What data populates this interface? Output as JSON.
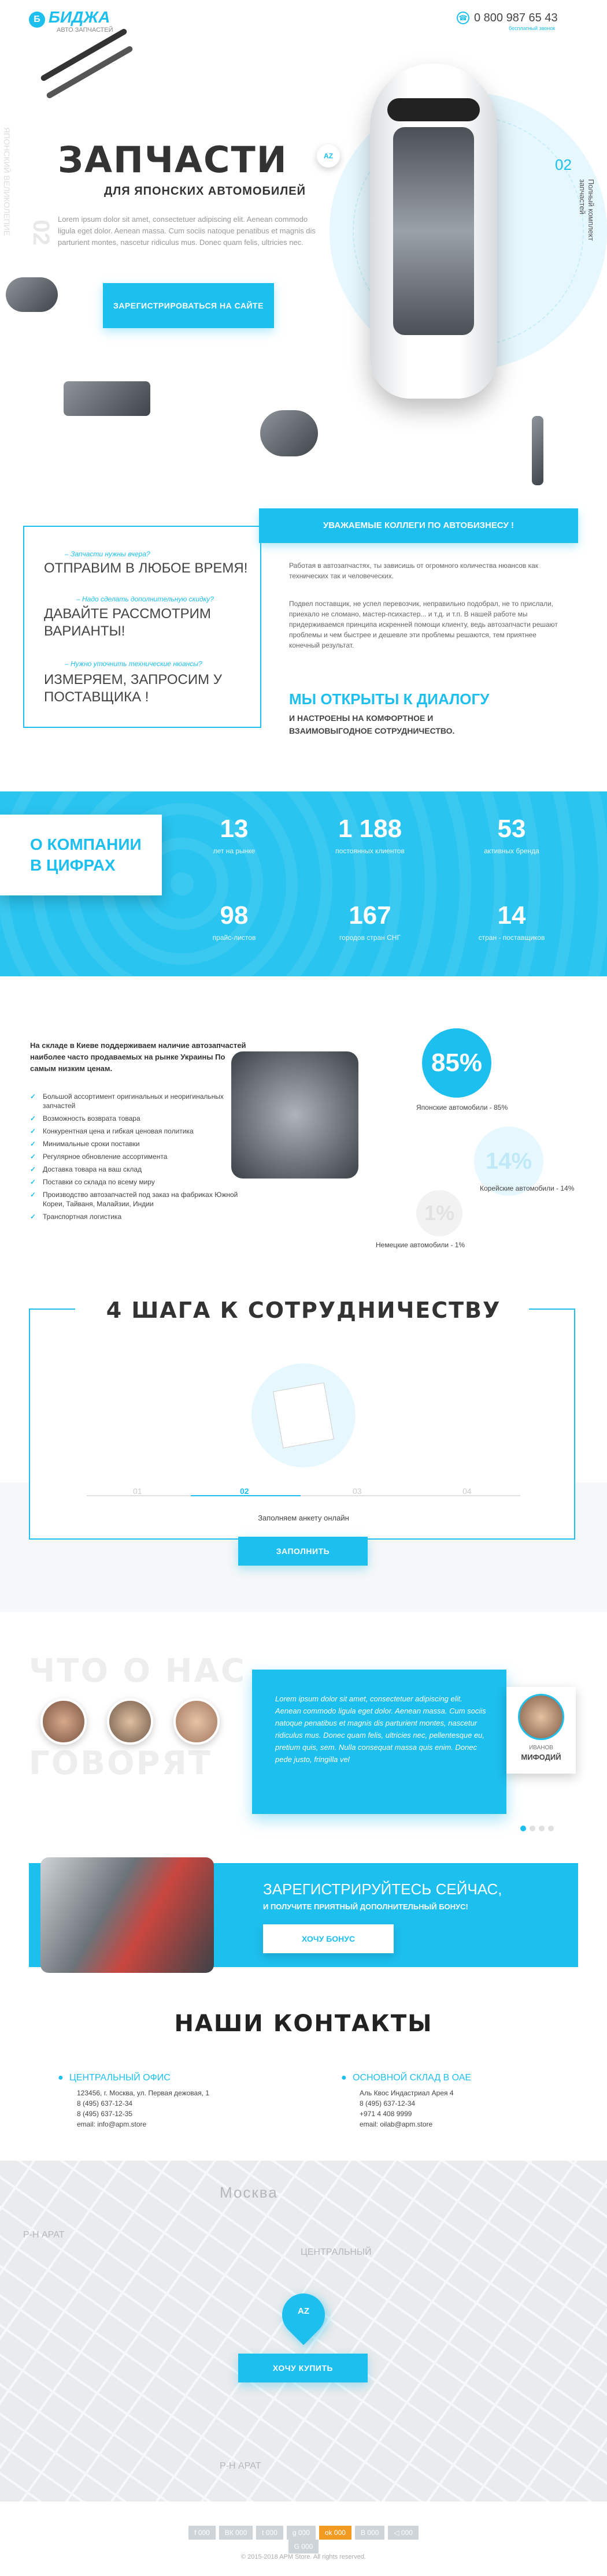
{
  "header": {
    "brand": "БИДЖА",
    "tagline": "АВТО ЗАПЧАСТЕЙ",
    "phone": "0 800 987 65 43",
    "phone_note": "бесплатный звонок"
  },
  "hero": {
    "title": "ЗАПЧАСТИ",
    "subtitle": "ДЛЯ ЯПОНСКИХ АВТОМОБИЛЕЙ",
    "text": "Lorem ipsum dolor sit amet, consectetuer adipiscing elit. Aenean commodo ligula eget dolor. Aenean massa. Cum sociis natoque penatibus et magnis dis parturient montes, nascetur ridiculus mus. Donec quam felis, ultricies nec.",
    "button": "ЗАРЕГИСТРИРОВАТЬСЯ НА САЙТЕ",
    "side_left": "ЯПОНСКИЙ ВЕЛИКОЛЕПИЕ",
    "side_num_left": "02",
    "side_num_right": "02",
    "side_right": "Полный комплект запчастей"
  },
  "collegues": {
    "q1": "– Запчасти нужны вчера?",
    "a1": "ОТПРАВИМ В ЛЮБОЕ ВРЕМЯ!",
    "q2": "– Надо сделать дополнительную скидку?",
    "a2": "ДАВАЙТЕ РАССМОТРИМ ВАРИАНТЫ!",
    "q3": "– Нужно уточнить технические нюансы?",
    "a3": "ИЗМЕРЯЕМ, ЗАПРОСИМ У ПОСТАВЩИКА !",
    "banner": "УВАЖАЕМЫЕ КОЛЛЕГИ ПО АВТОБИЗНЕСУ !",
    "p1": "Работая в автозапчастях, ты зависишь от огромного количества нюансов как технических так и человеческих.",
    "p2": "Подвел поставщик, не успел перевозчик, неправильно подобрал, не то прислали, приехало не сломано, мастер-психастер... и т.д. и т.п. В нашей работе мы придерживаемся принципа искренней помощи клиенту, ведь автозапчасти решают проблемы и чем быстрее и дешевле эти проблемы решаются, тем приятнее конечный результат.",
    "open": "МЫ ОТКРЫТЫ К ДИАЛОГУ",
    "open_sub": "И НАСТРОЕНЫ НА КОМФОРТНОЕ И ВЗАИМОВЫГОДНОЕ СОТРУДНИЧЕСТВО."
  },
  "about": {
    "title": "О КОМПАНИИ В ЦИФРАХ",
    "stats": [
      {
        "n": "13",
        "l": "лет на рынке"
      },
      {
        "n": "1 188",
        "l": "постоянных клиентов"
      },
      {
        "n": "53",
        "l": "активных бренда"
      },
      {
        "n": "98",
        "l": "прайс-листов"
      },
      {
        "n": "167",
        "l": "городов стран СНГ"
      },
      {
        "n": "14",
        "l": "стран - поставщиков"
      }
    ]
  },
  "stock": {
    "intro": "На складе в Киеве поддерживаем наличие автозапчастей наиболее часто продаваемых на рынке Украины По самым низким ценам.",
    "items": [
      "Большой ассортимент оригинальных и неоригинальных запчастей",
      "Возможность возврата товара",
      "Конкурентная цена и гибкая ценовая политика",
      "Минимальные сроки поставки",
      "Регулярное обновление ассортимента",
      "Доставка товара на ваш склад",
      "Поставки со склада по всему миру",
      "Производство автозапчастей под заказ на фабриках Южной Кореи, Тайваня, Малайзии, Индии",
      "Транспортная логистика"
    ],
    "p1": "85%",
    "l1": "Японские автомобили - 85%",
    "p2": "14%",
    "l2": "Корейские автомобили - 14%",
    "p3": "1%",
    "l3": "Немецкие автомобили - 1%"
  },
  "steps": {
    "title": "4 ШАГА К СОТРУДНИЧЕСТВУ",
    "s1": "01",
    "s2": "02",
    "s3": "03",
    "s4": "04",
    "caption": "Заполняем анкету онлайн",
    "button": "ЗАПОЛНИТЬ"
  },
  "reviews": {
    "t1": "ЧТО О НАС",
    "t2": "ГОВОРЯТ",
    "text": "Lorem ipsum dolor sit amet, consectetuer adipiscing elit. Aenean commodo ligula eget dolor. Aenean massa. Cum sociis natoque penatibus et magnis dis parturient montes, nascetur ridiculus mus. Donec quam felis, ultricies nec, pellentesque eu, pretium quis, sem. Nulla consequat massa quis enim. Donec pede justo, fringilla vel",
    "name1": "ИВАНОВ",
    "name2": "МИФОДИЙ"
  },
  "register": {
    "title": "ЗАРЕГИСТРИРУЙТЕСЬ СЕЙЧАС,",
    "sub": "И ПОЛУЧИТЕ ПРИЯТНЫЙ ДОПОЛНИТЕЛЬНЫЙ БОНУС!",
    "button": "ХОЧУ БОНУС"
  },
  "contacts": {
    "title": "НАШИ КОНТАКТЫ",
    "o1": "ЦЕНТРАЛЬНЫЙ ОФИС",
    "o1_addr": "123456, г. Москва, ул. Первая дежовая, 1",
    "o1_p1": "8 (495) 637-12-34",
    "o1_p2": "8 (495) 637-12-35",
    "o1_mail": "email: info@apm.store",
    "o2": "ОСНОВНОЙ СКЛАД В ОАЕ",
    "o2_addr": "Аль Квос Индастриал Арея 4",
    "o2_p1": "8 (495) 637-12-34",
    "o2_p2": "+971 4 408 9999",
    "o2_mail": "email: oilab@apm.store"
  },
  "map": {
    "city": "Москва",
    "button": "ХОЧУ КУПИТЬ",
    "labels": [
      "Р-Н АРАТ",
      "ЦЕНТРАЛЬНЫЙ",
      "Р-Н АРАТ"
    ]
  },
  "footer": {
    "copy": "© 2015-2018 APM Store. All rights reserved.",
    "social": [
      "f 000",
      "ВК 000",
      "t 000",
      "g 000",
      "ok 000",
      "B 000",
      "◁ 000",
      "G 000"
    ]
  }
}
